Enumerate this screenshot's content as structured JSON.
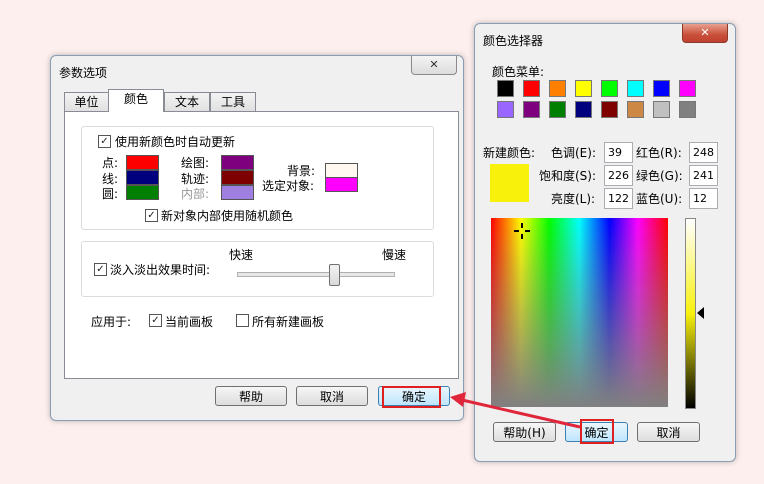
{
  "prefs": {
    "title": "参数选项",
    "tabs": [
      "单位",
      "颜色",
      "文本",
      "工具"
    ],
    "auto_update": "使用新颜色时自动更新",
    "labels": {
      "point": "点:",
      "line": "线:",
      "circle": "圆:",
      "plot": "绘图:",
      "trace": "轨迹:",
      "interior": "内部:",
      "background": "背景:",
      "selected": "选定对象:"
    },
    "random_interior": "新对象内部使用随机颜色",
    "fade_label": "淡入淡出效果时间:",
    "fast": "快速",
    "slow": "慢速",
    "fade_level": 0.62,
    "apply_to": "应用于:",
    "current_board": "当前画板",
    "all_new_boards": "所有新建画板",
    "help": "帮助",
    "cancel": "取消",
    "ok": "确定",
    "colors": {
      "point": "#ff0000",
      "line": "#00007f",
      "circle": "#007f00",
      "plot": "#7f007f",
      "trace": "#7f0000",
      "interior": "#9f7fdf",
      "background": "#fff8f0",
      "selected": "#ff00ff"
    }
  },
  "picker": {
    "title": "颜色选择器",
    "menu_label": "颜色菜单:",
    "palette_row1": [
      "#000000",
      "#ff0000",
      "#ff7f00",
      "#ffff00",
      "#00ff00",
      "#00ffff",
      "#0000ff",
      "#ff00ff"
    ],
    "palette_row2": [
      "#9966ff",
      "#7f007f",
      "#007f00",
      "#00007f",
      "#7f0000",
      "#cc8844",
      "#c0c0c0",
      "#808080"
    ],
    "new_color_label": "新建颜色:",
    "new_color": "#f8f10c",
    "hue_label": "色调(E):",
    "hue": "39",
    "sat_label": "饱和度(S):",
    "sat": "226",
    "lum_label": "亮度(L):",
    "lum": "122",
    "red_label": "红色(R):",
    "red": "248",
    "green_label": "绿色(G):",
    "green": "241",
    "blue_label": "蓝色(U):",
    "blue": "12",
    "help": "帮助(H)",
    "ok": "确定",
    "cancel": "取消"
  }
}
